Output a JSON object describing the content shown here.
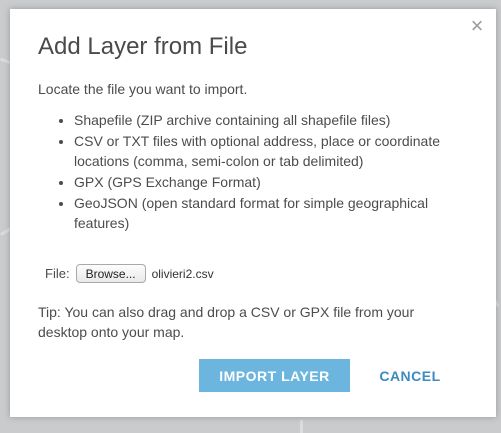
{
  "dialog": {
    "title": "Add Layer from File",
    "intro": "Locate the file you want to import.",
    "formats": [
      "Shapefile (ZIP archive containing all shapefile files)",
      "CSV or TXT files with optional address, place or coordinate locations (comma, semi-colon or tab delimited)",
      "GPX (GPS Exchange Format)",
      "GeoJSON (open standard format for simple geographical features)"
    ],
    "file_label": "File:",
    "browse_label": "Browse...",
    "file_name": "olivieri2.csv",
    "tip": "Tip: You can also drag and drop a CSV or GPX file from your desktop onto your map.",
    "import_label": "IMPORT LAYER",
    "cancel_label": "CANCEL",
    "close_glyph": "×"
  },
  "colors": {
    "import_button": "#6cb5de",
    "cancel_text": "#3a8cc1",
    "backdrop": "#c9cbcc"
  }
}
